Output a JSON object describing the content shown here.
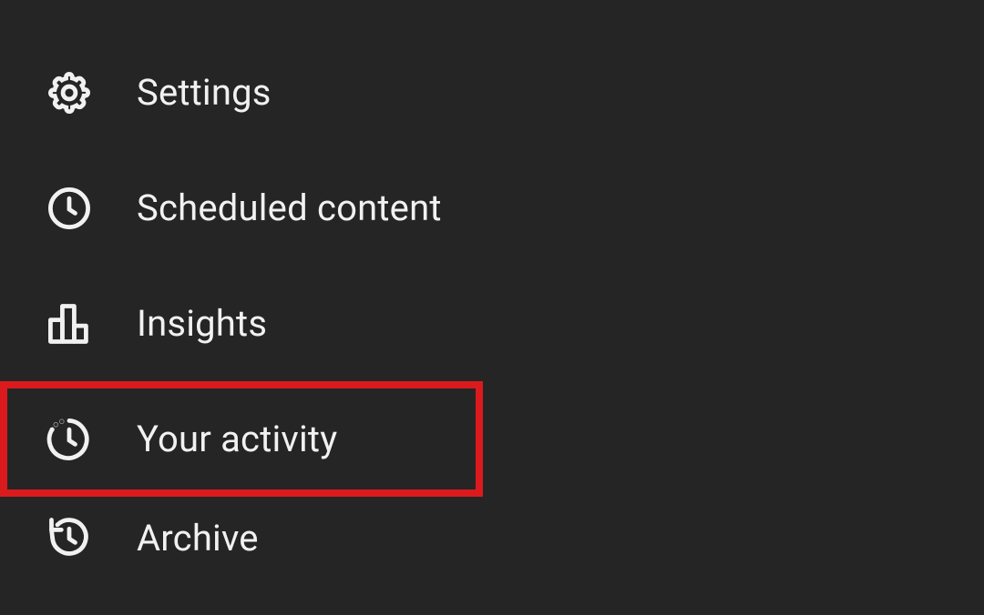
{
  "menu": {
    "items": [
      {
        "label": "Settings"
      },
      {
        "label": "Scheduled content"
      },
      {
        "label": "Insights"
      },
      {
        "label": "Your activity"
      },
      {
        "label": "Archive"
      }
    ]
  }
}
